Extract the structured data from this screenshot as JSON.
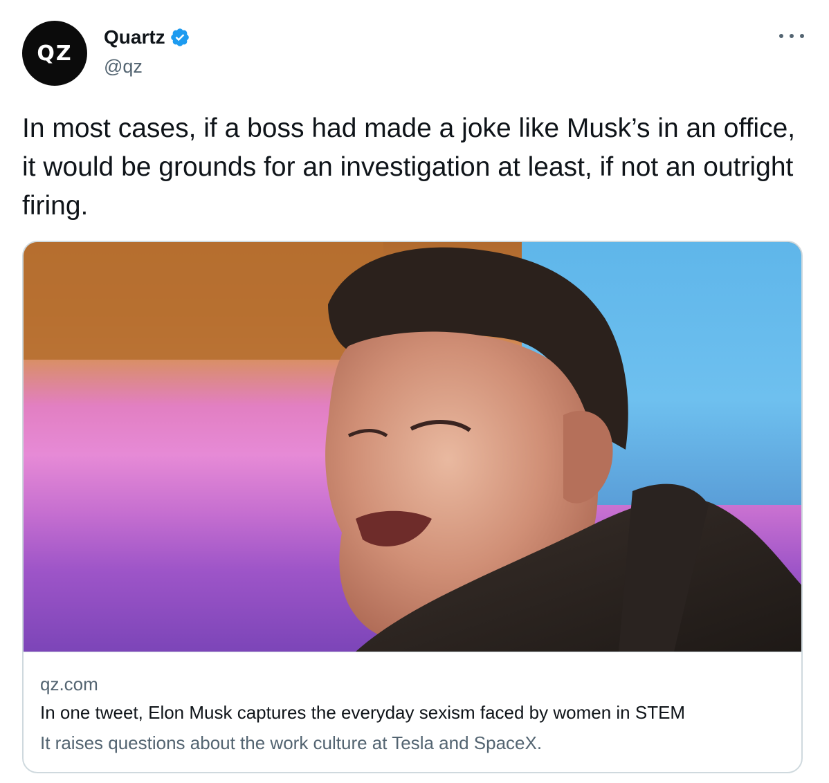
{
  "tweet": {
    "avatar_text": "QZ",
    "display_name": "Quartz",
    "handle": "@qz",
    "text": "In most cases, if a boss had made a joke like Musk’s in an office, it would be grounds for an investigation at least, if not an outright firing.",
    "verified_icon": "verified-badge-icon",
    "more_icon": "more-options-icon"
  },
  "card": {
    "image_subject": "portrait-photo",
    "domain": "qz.com",
    "title": "In one tweet, Elon Musk captures the everyday sexism faced by women in STEM",
    "description": "It raises questions about the work culture at Tesla and SpaceX."
  },
  "colors": {
    "verified_blue": "#1d9bf0",
    "text_primary": "#0f1419",
    "text_secondary": "#536471",
    "border": "#cfd9de"
  }
}
